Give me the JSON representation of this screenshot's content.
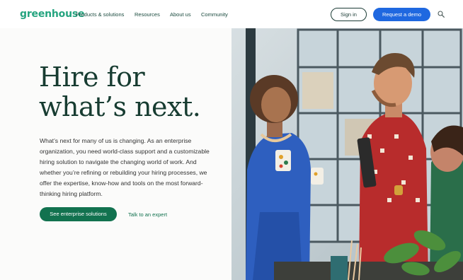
{
  "nav": {
    "logo": "greenhouse",
    "items": [
      "Products & solutions",
      "Resources",
      "About us",
      "Community"
    ],
    "sign_in": "Sign in",
    "request_demo": "Request a demo"
  },
  "hero": {
    "headline_line1": "Hire for",
    "headline_line2": "what’s next.",
    "body": "What’s next for many of us is changing. As an enterprise organization, you need world-class support and a customizable hiring solution to navigate the changing world of work. And whether you’re refining or rebuilding your hiring processes, we offer the expertise, know-how and tools on the most forward-thinking hiring platform.",
    "primary_cta": "See enterprise solutions",
    "secondary_cta": "Talk to an expert"
  },
  "colors": {
    "brand_green": "#24a47f",
    "heading_green": "#173c31",
    "cta_green": "#12724f",
    "accent_blue": "#1f68e0"
  }
}
